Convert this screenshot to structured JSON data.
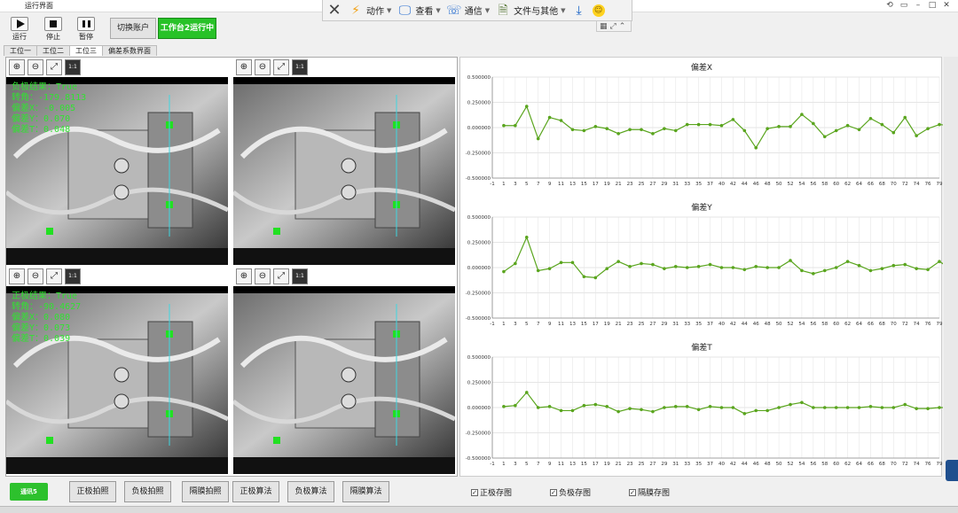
{
  "window": {
    "title": "运行界面"
  },
  "floating_toolbar": {
    "items": [
      {
        "label": "动作",
        "icon": "bolt-icon"
      },
      {
        "label": "查看",
        "icon": "monitor-icon"
      },
      {
        "label": "通信",
        "icon": "phone-icon"
      },
      {
        "label": "文件与其他",
        "icon": "file-icon"
      }
    ]
  },
  "toolbar": {
    "run_label": "运行",
    "stop_label": "停止",
    "pause_label": "暂停",
    "switch_account_label": "切换账户",
    "status_label": "工作台2运行中",
    "status_color": "#28c228"
  },
  "tabs": [
    "工位一",
    "工位二",
    "工位三",
    "偏差系数界面"
  ],
  "active_tab": "工位三",
  "cameras": [
    {
      "overlay": [
        "负极结果：True",
        "转角：-179.8113",
        "偏差X：-0.005",
        "偏差Y：0.070",
        "偏差T：0.048"
      ]
    },
    {
      "overlay": []
    },
    {
      "overlay": [
        "正极结果：True",
        "转角：-90.4627",
        "偏差X：0.080",
        "偏差Y：0.073",
        "偏差T：0.039"
      ]
    },
    {
      "overlay": []
    }
  ],
  "camera_tools": {
    "fit_label": "1:1"
  },
  "chart_data": [
    {
      "type": "line",
      "title": "偏差X",
      "ylim": [
        -0.5,
        0.5
      ],
      "yticks": [
        "0.500000",
        "0.250000",
        "0.000000",
        "-0.250000",
        "-0.500000"
      ],
      "xticks": [
        "-1",
        "1",
        "3",
        "5",
        "7",
        "9",
        "11",
        "13",
        "15",
        "17",
        "19",
        "21",
        "23",
        "25",
        "27",
        "29",
        "31",
        "33",
        "35",
        "37",
        "40",
        "42",
        "44",
        "46",
        "48",
        "50",
        "52",
        "54",
        "56",
        "58",
        "60",
        "62",
        "64",
        "66",
        "68",
        "70",
        "72",
        "74",
        "76",
        "79"
      ],
      "x": [
        1,
        2,
        3,
        4,
        5,
        6,
        7,
        8,
        9,
        10,
        11,
        12,
        13,
        14,
        15,
        16,
        17,
        18,
        19,
        20,
        21,
        22,
        23,
        24,
        25,
        26,
        27,
        28,
        29,
        30,
        31,
        32,
        33,
        34,
        35,
        36,
        37,
        38,
        39,
        40
      ],
      "values": [
        0.02,
        0.02,
        0.21,
        -0.11,
        0.1,
        0.07,
        -0.02,
        -0.03,
        0.01,
        -0.01,
        -0.06,
        -0.02,
        -0.02,
        -0.06,
        -0.01,
        -0.03,
        0.03,
        0.03,
        0.03,
        0.02,
        0.08,
        -0.03,
        -0.2,
        -0.01,
        0.01,
        0.01,
        0.13,
        0.04,
        -0.09,
        -0.03,
        0.02,
        -0.02,
        0.09,
        0.03,
        -0.05,
        0.1,
        -0.08,
        -0.01,
        0.03,
        0.02
      ],
      "color": "#5aa51e"
    },
    {
      "type": "line",
      "title": "偏差Y",
      "ylim": [
        -0.5,
        0.5
      ],
      "yticks": [
        "0.500000",
        "0.250000",
        "0.000000",
        "-0.250000",
        "-0.500000"
      ],
      "xticks": [
        "-1",
        "1",
        "3",
        "5",
        "7",
        "9",
        "11",
        "13",
        "15",
        "17",
        "19",
        "21",
        "23",
        "25",
        "27",
        "29",
        "31",
        "33",
        "35",
        "37",
        "40",
        "42",
        "44",
        "46",
        "48",
        "50",
        "52",
        "54",
        "56",
        "58",
        "60",
        "62",
        "64",
        "66",
        "68",
        "70",
        "72",
        "74",
        "76",
        "79"
      ],
      "x": [
        1,
        2,
        3,
        4,
        5,
        6,
        7,
        8,
        9,
        10,
        11,
        12,
        13,
        14,
        15,
        16,
        17,
        18,
        19,
        20,
        21,
        22,
        23,
        24,
        25,
        26,
        27,
        28,
        29,
        30,
        31,
        32,
        33,
        34,
        35,
        36,
        37,
        38,
        39,
        40
      ],
      "values": [
        -0.04,
        0.04,
        0.3,
        -0.03,
        -0.01,
        0.05,
        0.05,
        -0.09,
        -0.1,
        -0.01,
        0.06,
        0.01,
        0.04,
        0.03,
        -0.01,
        0.01,
        0.0,
        0.01,
        0.03,
        0.0,
        0.0,
        -0.02,
        0.01,
        0.0,
        0.0,
        0.07,
        -0.03,
        -0.06,
        -0.03,
        0.0,
        0.06,
        0.02,
        -0.03,
        -0.01,
        0.02,
        0.03,
        -0.01,
        -0.02,
        0.06,
        -0.01
      ],
      "color": "#5aa51e"
    },
    {
      "type": "line",
      "title": "偏差T",
      "ylim": [
        -0.5,
        0.5
      ],
      "yticks": [
        "0.500000",
        "0.250000",
        "0.000000",
        "-0.250000",
        "-0.500000"
      ],
      "xticks": [
        "-1",
        "1",
        "3",
        "5",
        "7",
        "9",
        "11",
        "13",
        "15",
        "17",
        "19",
        "21",
        "23",
        "25",
        "27",
        "29",
        "31",
        "33",
        "35",
        "37",
        "40",
        "42",
        "44",
        "46",
        "48",
        "50",
        "52",
        "54",
        "56",
        "58",
        "60",
        "62",
        "64",
        "66",
        "68",
        "70",
        "72",
        "74",
        "76",
        "79"
      ],
      "x": [
        1,
        2,
        3,
        4,
        5,
        6,
        7,
        8,
        9,
        10,
        11,
        12,
        13,
        14,
        15,
        16,
        17,
        18,
        19,
        20,
        21,
        22,
        23,
        24,
        25,
        26,
        27,
        28,
        29,
        30,
        31,
        32,
        33,
        34,
        35,
        36,
        37,
        38,
        39,
        40
      ],
      "values": [
        0.01,
        0.02,
        0.15,
        0.0,
        0.01,
        -0.03,
        -0.03,
        0.02,
        0.03,
        0.01,
        -0.04,
        -0.01,
        -0.02,
        -0.04,
        0.0,
        0.01,
        0.01,
        -0.02,
        0.01,
        0.0,
        0.0,
        -0.06,
        -0.03,
        -0.03,
        0.0,
        0.03,
        0.05,
        0.0,
        0.0,
        0.0,
        0.0,
        0.0,
        0.01,
        0.0,
        0.0,
        0.03,
        -0.01,
        -0.01,
        0.0,
        0.0
      ],
      "color": "#5aa51e"
    }
  ],
  "bottom": {
    "comm_label": "通讯5",
    "buttons": [
      "正极拍照",
      "负极拍照",
      "隔膜拍照",
      "正极算法",
      "负极算法",
      "隔膜算法"
    ],
    "checkboxes": [
      "正极存图",
      "负极存图",
      "隔膜存图"
    ]
  }
}
